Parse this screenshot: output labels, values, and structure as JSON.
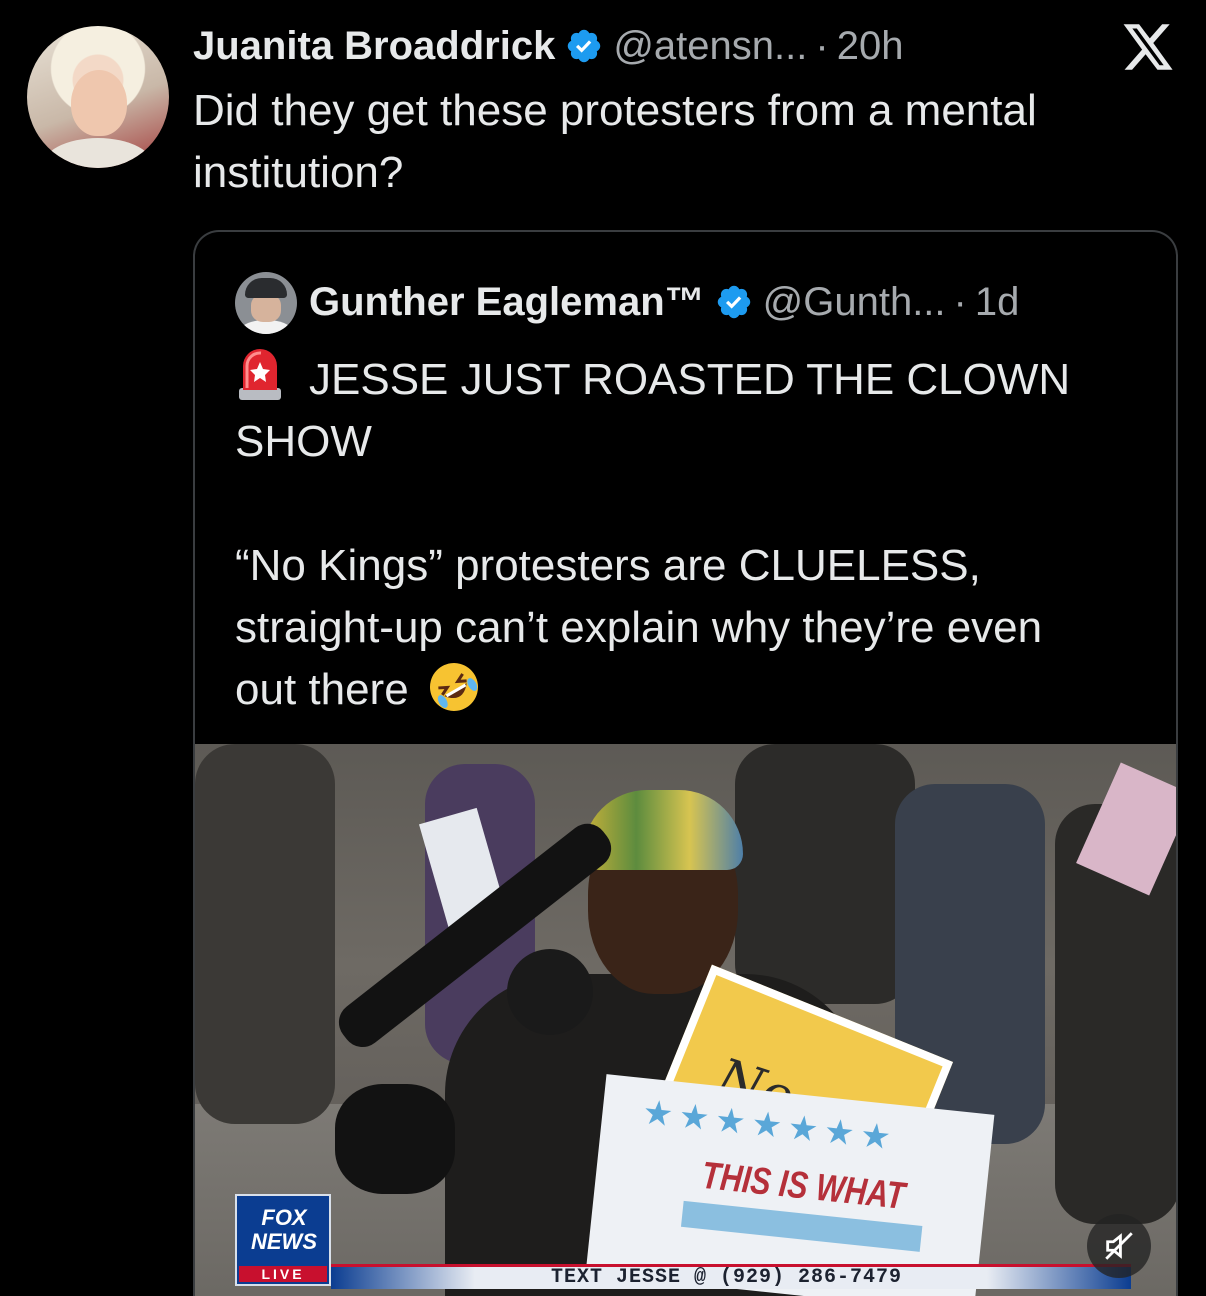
{
  "main_tweet": {
    "author_name": "Juanita Broaddrick",
    "handle": "@atensn...",
    "separator": "·",
    "time": "20h",
    "text_line1": "Did they get these protesters from a mental",
    "text_line2": "institution?"
  },
  "quoted_tweet": {
    "author_name": "Gunther Eagleman™",
    "handle": "@Gunth...",
    "separator": "·",
    "time": "1d",
    "headline_line1": "JESSE JUST ROASTED THE CLOWN",
    "headline_line2": "SHOW",
    "body_line1": "“No Kings” protesters are CLUELESS,",
    "body_line2": "straight-up can’t explain why they’re even",
    "body_line3": "out there",
    "emoji_siren": "rotating-light",
    "emoji_laugh": "rolling-on-floor-laughing"
  },
  "video": {
    "network_logo_line1": "FOX",
    "network_logo_line2": "NEWS",
    "live_badge": "LIVE",
    "ticker": "TEXT JESSE @ (929) 286-7479",
    "sign_yellow_text": "No",
    "sign_white_text": "THIS IS WHAT",
    "mute_icon": "muted-speaker-icon"
  },
  "icons": {
    "verified": "verified-badge-icon",
    "x_logo": "x-logo-icon"
  },
  "colors": {
    "background": "#000000",
    "verified_blue": "#1d9bf0",
    "text_primary": "#e7e9ea",
    "text_secondary": "#a6aaae"
  }
}
